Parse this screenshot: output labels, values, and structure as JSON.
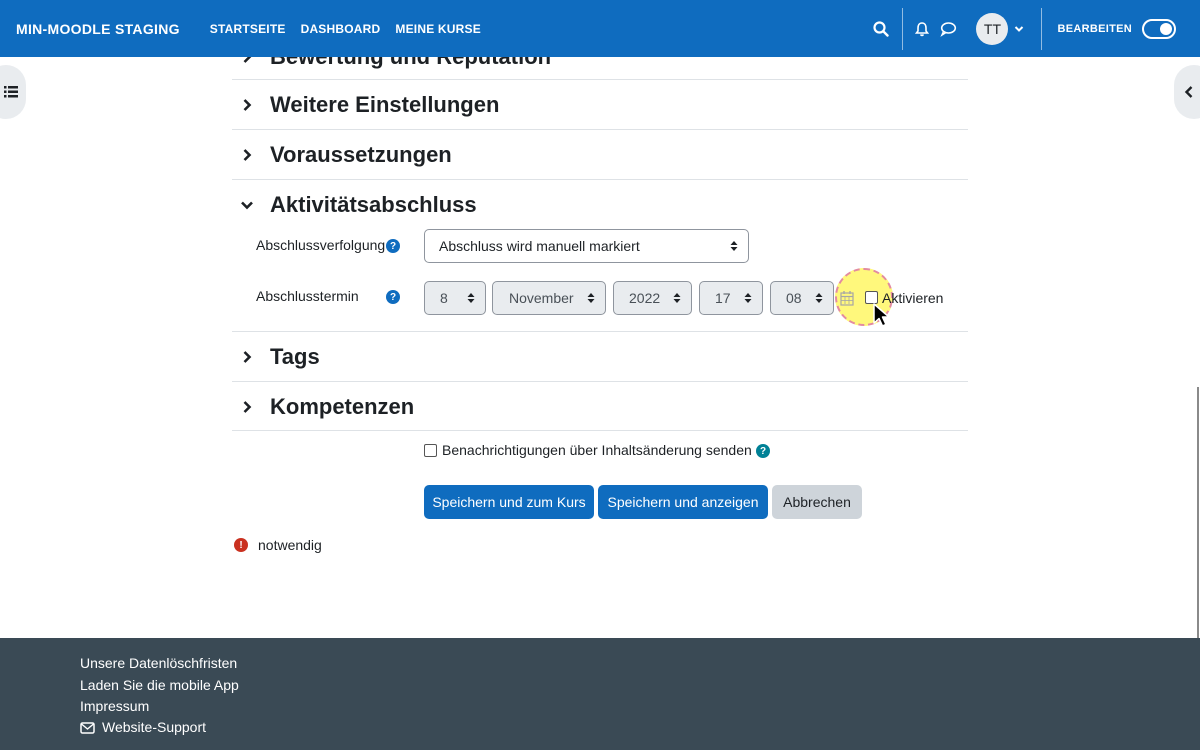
{
  "navbar": {
    "brand": "MIN-MOODLE STAGING",
    "links": [
      "STARTSEITE",
      "DASHBOARD",
      "MEINE KURSE"
    ],
    "avatar_initials": "TT",
    "edit_label": "BEARBEITEN",
    "icons": [
      "search-icon",
      "bell-icon",
      "chat-icon",
      "chevron-down-icon"
    ],
    "edit_mode_on": true,
    "color": "#0f6cbf"
  },
  "sections": {
    "partial_title": "Bewertung und Reputation",
    "weitere": "Weitere Einstellungen",
    "voraussetzungen": "Voraussetzungen",
    "aktivitaet": "Aktivitätsabschluss",
    "tags": "Tags",
    "kompetenzen": "Kompetenzen"
  },
  "completion": {
    "tracking_label": "Abschlussverfolgung",
    "tracking_value": "Abschluss wird manuell markiert",
    "date_label": "Abschlusstermin",
    "day": "8",
    "month": "November",
    "year": "2022",
    "hour": "17",
    "minute": "08",
    "enable_label": "Aktivieren",
    "enabled": false
  },
  "notify": {
    "label": "Benachrichtigungen über Inhaltsänderung senden",
    "checked": false
  },
  "buttons": {
    "save_course": "Speichern und zum Kurs",
    "save_show": "Speichern und anzeigen",
    "cancel": "Abbrechen"
  },
  "required_note": "notwendig",
  "footer": {
    "links": [
      "Unsere Datenlöschfristen",
      "Laden Sie die mobile App",
      "Impressum",
      "Website-Support"
    ],
    "color": "#3a4a55"
  }
}
